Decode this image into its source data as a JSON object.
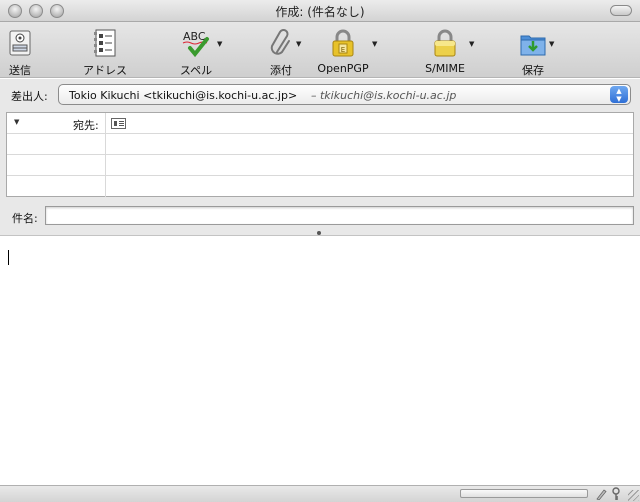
{
  "window": {
    "title": "作成: (件名なし)"
  },
  "toolbar": {
    "items": [
      {
        "label": "送信",
        "icon": "send-icon",
        "has_menu": false
      },
      {
        "label": "アドレス",
        "icon": "address-book-icon",
        "has_menu": false
      },
      {
        "label": "スペル",
        "icon": "spellcheck-icon",
        "icon_text": "ABC",
        "has_menu": true
      },
      {
        "label": "添付",
        "icon": "paperclip-icon",
        "has_menu": true
      },
      {
        "label": "OpenPGP",
        "icon": "lock-openpgp-icon",
        "icon_text": "E",
        "has_menu": true
      },
      {
        "label": "S/MIME",
        "icon": "lock-smime-icon",
        "has_menu": true
      },
      {
        "label": "保存",
        "icon": "save-folder-icon",
        "has_menu": true
      }
    ]
  },
  "header": {
    "from_label": "差出人:",
    "from_value": "Tokio Kikuchi <tkikuchi@is.kochi-u.ac.jp>",
    "from_alias": "– tkikuchi@is.kochi-u.ac.jp",
    "to_label": "宛先:",
    "subject_label": "件名:",
    "subject_value": ""
  },
  "colors": {
    "toolbar_bg": "#dcdcdc",
    "select_arrow": "#2f6fd6",
    "lock_gold": "#e8c22a",
    "save_blue": "#4d8fd8"
  }
}
